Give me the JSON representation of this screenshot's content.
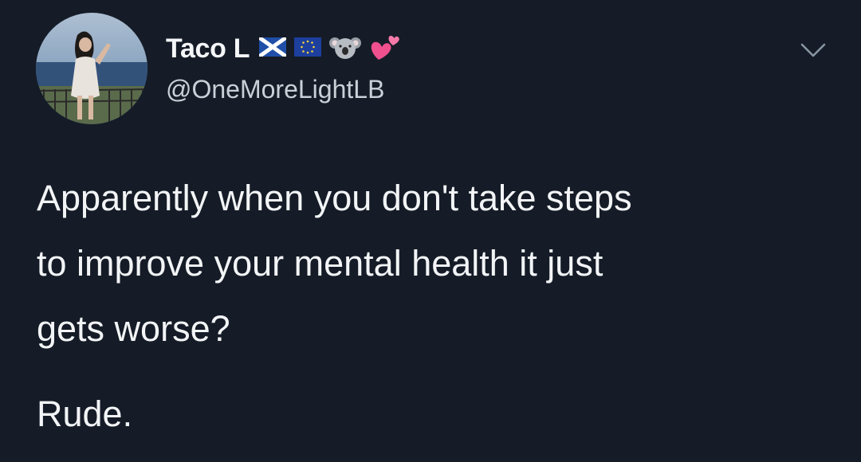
{
  "author": {
    "display_name": "Taco L",
    "handle": "@OneMoreLightLB",
    "badges": [
      "scotland-flag-icon",
      "eu-flag-icon",
      "koala-icon",
      "two-hearts-icon"
    ]
  },
  "tweet": {
    "lines": [
      "Apparently when you don't take steps",
      "to improve your mental health it just",
      "gets worse?"
    ],
    "closing": "Rude."
  },
  "menu_icon": "chevron-down-icon",
  "colors": {
    "background": "#151c27",
    "text": "#f2f4f6",
    "handle": "#c9d0d8",
    "chevron": "#8a96a3"
  }
}
